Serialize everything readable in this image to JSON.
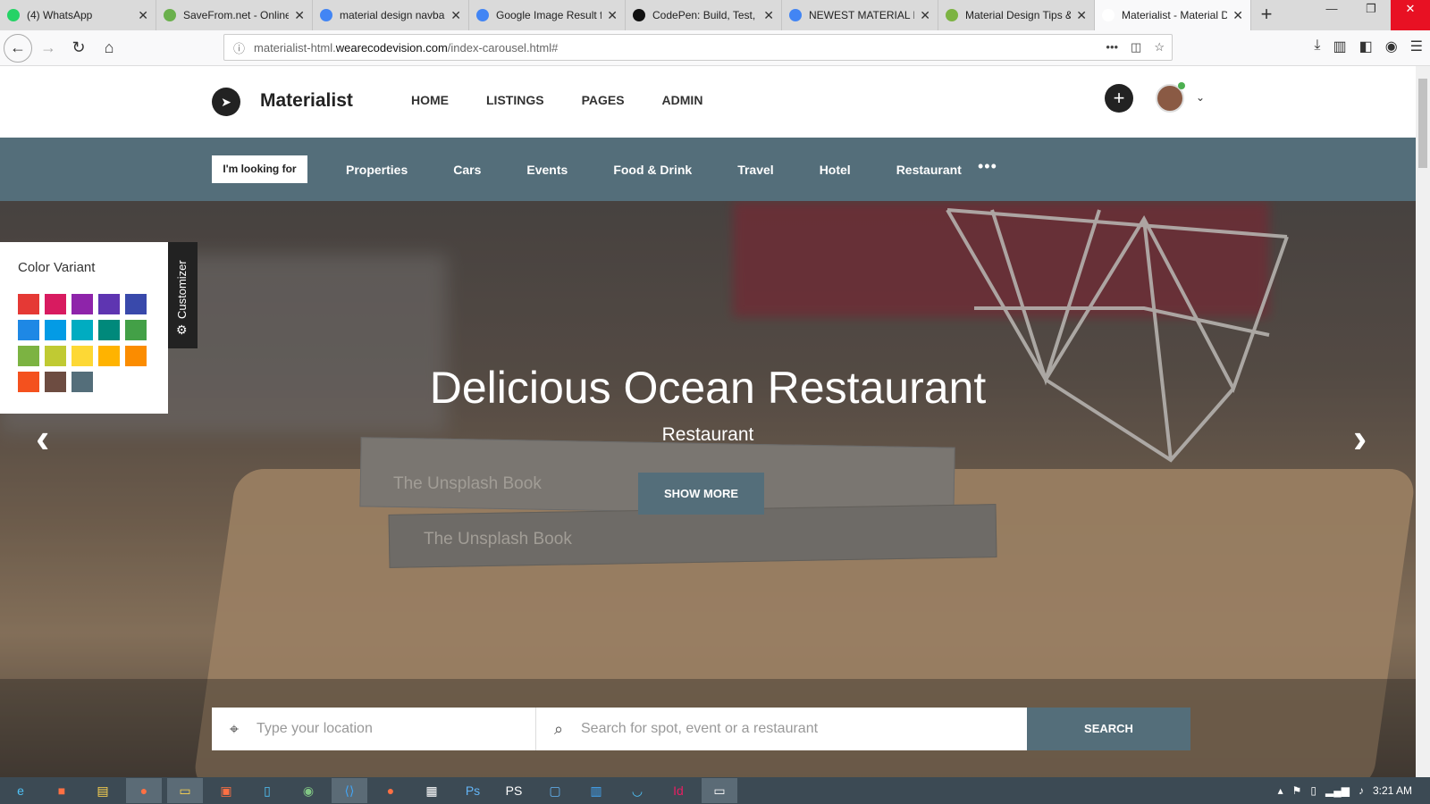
{
  "browser": {
    "tabs": [
      {
        "title": "(4) WhatsApp",
        "color": "#25d366"
      },
      {
        "title": "SaveFrom.net - Online",
        "color": "#6ab04c"
      },
      {
        "title": "material design navba",
        "color": "#4285f4"
      },
      {
        "title": "Google Image Result f",
        "color": "#4285f4"
      },
      {
        "title": "CodePen: Build, Test,",
        "color": "#111111"
      },
      {
        "title": "NEWEST MATERIAL D",
        "color": "#4285f4"
      },
      {
        "title": "Material Design Tips &",
        "color": "#7cb342"
      },
      {
        "title": "Materialist - Material Direc",
        "color": "#ffffff"
      }
    ],
    "url_prefix": "materialist-html.",
    "url_domain": "wearecodevision.com",
    "url_path": "/index-carousel.html#"
  },
  "site": {
    "brand": "Materialist",
    "nav": [
      "HOME",
      "LISTINGS",
      "PAGES",
      "ADMIN"
    ],
    "looking_for": "I'm looking for",
    "categories": [
      "Properties",
      "Cars",
      "Events",
      "Food & Drink",
      "Travel",
      "Hotel",
      "Restaurant"
    ]
  },
  "hero": {
    "title": "Delicious Ocean Restaurant",
    "subtitle": "Restaurant",
    "button": "SHOW MORE",
    "book_label": "The Unsplash Book"
  },
  "search": {
    "location_placeholder": "Type your location",
    "query_placeholder": "Search for spot, event or a restaurant",
    "button": "SEARCH"
  },
  "customizer": {
    "title": "Color Variant",
    "tab_label": "Customizer",
    "swatches": [
      "#e53935",
      "#d81b60",
      "#8e24aa",
      "#5e35b1",
      "#3949ab",
      "#1e88e5",
      "#039be5",
      "#00acc1",
      "#00897b",
      "#43a047",
      "#7cb342",
      "#c0ca33",
      "#fdd835",
      "#ffb300",
      "#fb8c00",
      "#f4511e",
      "#6d4c41",
      "#546e7a"
    ]
  },
  "taskbar": {
    "clock": "3:21 AM"
  },
  "colors": {
    "accent": "#546e7a"
  }
}
